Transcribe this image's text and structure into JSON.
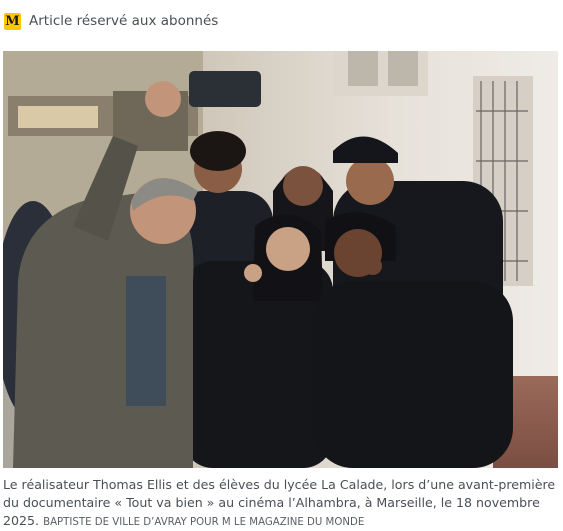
{
  "header": {
    "badge_icon": "M",
    "badge_label": "Article réservé aux abonnés",
    "badge_color": "#ffc700"
  },
  "photo": {
    "icon": "photo"
  },
  "caption": {
    "text": "Le réalisateur Thomas Ellis et des élèves du lycée La Calade, lors d’une avant-première du documentaire « Tout va bien » au cinéma l’Alhambra, à Marseille, le 18 novembre 2025.",
    "credit": "BAPTISTE DE VILLE D’AVRAY POUR M LE MAGAZINE DU MONDE"
  }
}
